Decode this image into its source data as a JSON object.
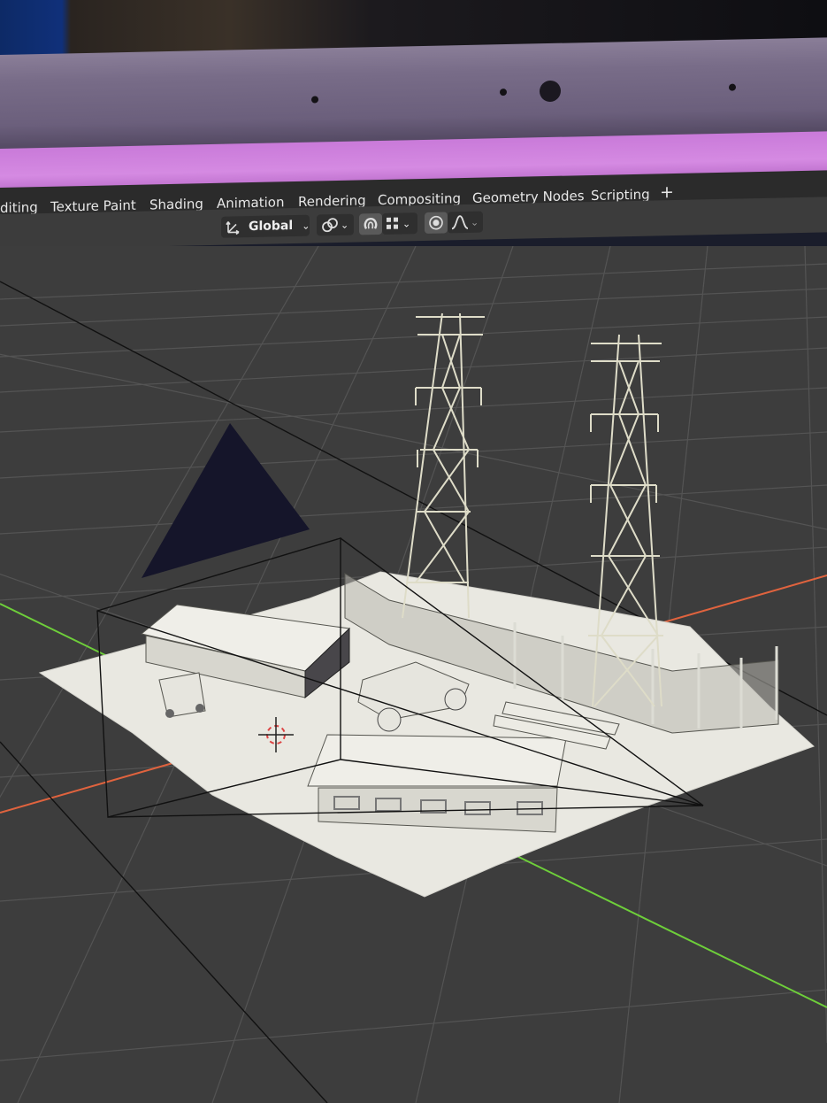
{
  "topbar": {
    "tabs": [
      {
        "label": "diting"
      },
      {
        "label": "Texture Paint"
      },
      {
        "label": "Shading"
      },
      {
        "label": "Animation"
      },
      {
        "label": "Rendering"
      },
      {
        "label": "Compositing"
      },
      {
        "label": "Geometry Nodes"
      },
      {
        "label": "Scripting"
      }
    ],
    "add_label": "+"
  },
  "header": {
    "orientation_value": "Global",
    "icons": [
      "transform-orientation-icon",
      "pivot-link-icon",
      "snap-magnet-icon",
      "snap-grid-icon",
      "proportional-edit-icon",
      "falloff-curve-icon"
    ]
  },
  "colors": {
    "axis_x": "#e0633e",
    "axis_y": "#6ecf3a",
    "grid": "#545454",
    "viewport_bg": "#3d3d3d",
    "model": "#e9e8e1",
    "camera_triangle": "#15152a"
  }
}
